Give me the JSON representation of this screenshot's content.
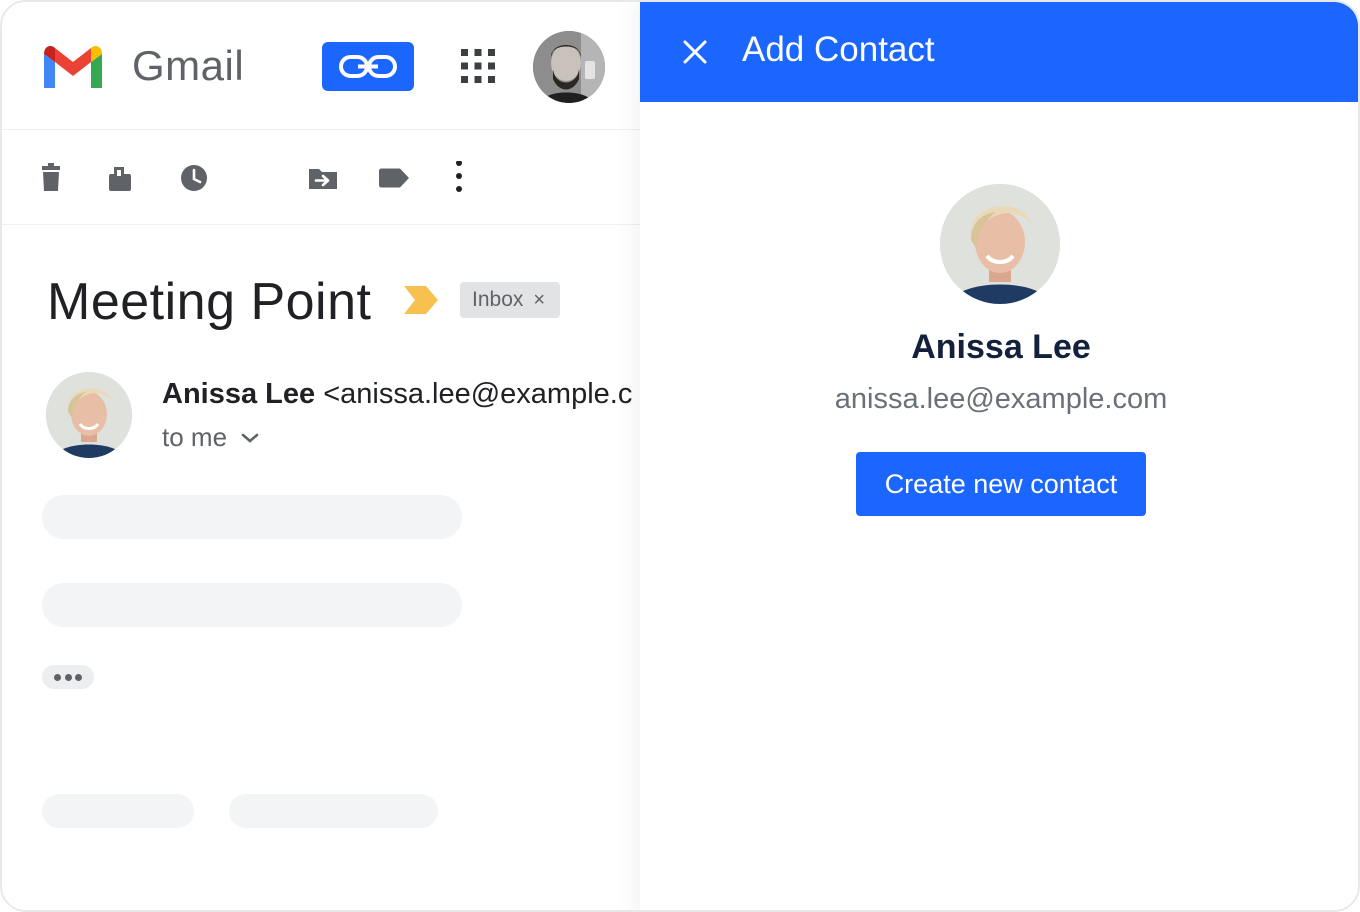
{
  "colors": {
    "accent": "#1a66ff",
    "importance": "#f6c14f",
    "gmail_red": "#ea4335",
    "gmail_blue": "#4285f4",
    "gmail_green": "#34a853",
    "gmail_yellow": "#fbbc04"
  },
  "gmail": {
    "brand": "Gmail",
    "header_icons": [
      "gmail-logo-icon",
      "extension-chain-icon",
      "apps-grid-icon"
    ],
    "toolbar_icons": [
      "trash-icon",
      "archive-icon",
      "snooze-clock-icon",
      "move-to-icon",
      "label-icon",
      "more-vertical-icon"
    ],
    "email": {
      "subject": "Meeting Point",
      "label": "Inbox",
      "label_remove": "×",
      "sender_name": "Anissa Lee",
      "sender_email": "<anissa.lee@example.c",
      "to": "to me"
    }
  },
  "panel": {
    "title": "Add Contact",
    "contact": {
      "name": "Anissa Lee",
      "email": "anissa.lee@example.com"
    },
    "create_button": "Create new contact"
  }
}
